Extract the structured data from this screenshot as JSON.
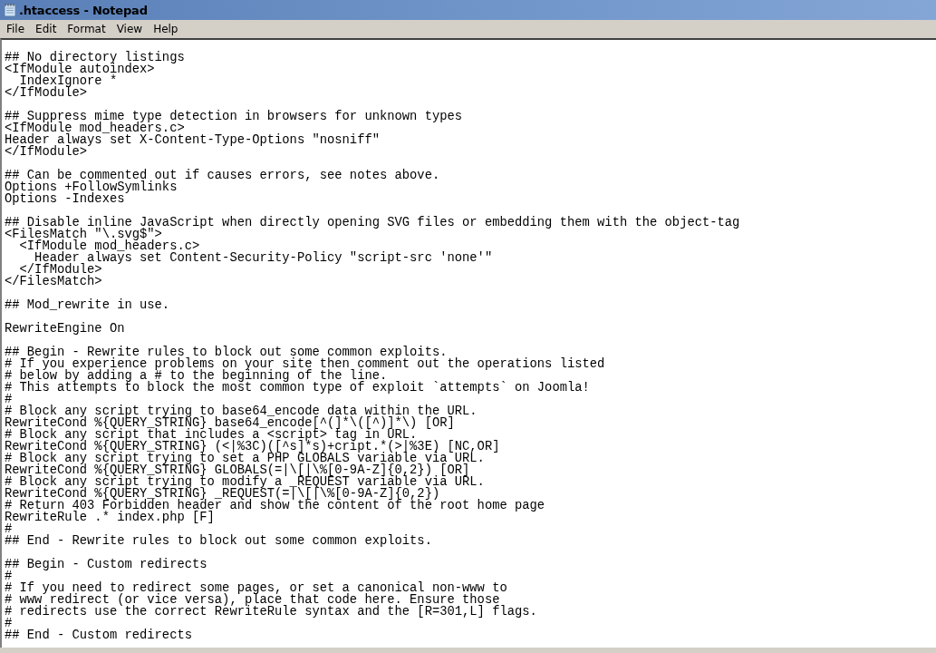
{
  "window": {
    "title": ".htaccess - Notepad"
  },
  "menu": [
    "File",
    "Edit",
    "Format",
    "View",
    "Help"
  ],
  "editor": {
    "blocks": [
      [
        "## No directory listings",
        "<IfModule autoindex>",
        "  IndexIgnore *",
        "</IfModule>"
      ],
      [
        "## Suppress mime type detection in browsers for unknown types",
        "<IfModule mod_headers.c>",
        "Header always set X-Content-Type-Options \"nosniff\"",
        "</IfModule>"
      ],
      [
        "## Can be commented out if causes errors, see notes above.",
        "Options +FollowSymlinks",
        "Options -Indexes"
      ],
      [
        "## Disable inline JavaScript when directly opening SVG files or embedding them with the object-tag",
        "<FilesMatch \"\\.svg$\">",
        "  <IfModule mod_headers.c>",
        "    Header always set Content-Security-Policy \"script-src 'none'\"",
        "  </IfModule>",
        "</FilesMatch>"
      ],
      [
        "## Mod_rewrite in use."
      ],
      [
        "RewriteEngine On"
      ],
      [
        "## Begin - Rewrite rules to block out some common exploits.",
        "# If you experience problems on your site then comment out the operations listed",
        "# below by adding a # to the beginning of the line.",
        "# This attempts to block the most common type of exploit `attempts` on Joomla!",
        "#",
        "# Block any script trying to base64_encode data within the URL.",
        "RewriteCond %{QUERY_STRING} base64_encode[^(]*\\([^)]*\\) [OR]",
        "# Block any script that includes a <script> tag in URL.",
        "RewriteCond %{QUERY_STRING} (<|%3C)([^s]*s)+cript.*(>|%3E) [NC,OR]",
        "# Block any script trying to set a PHP GLOBALS variable via URL.",
        "RewriteCond %{QUERY_STRING} GLOBALS(=|\\[|\\%[0-9A-Z]{0,2}) [OR]",
        "# Block any script trying to modify a _REQUEST variable via URL.",
        "RewriteCond %{QUERY_STRING} _REQUEST(=|\\[|\\%[0-9A-Z]{0,2})",
        "# Return 403 Forbidden header and show the content of the root home page",
        "RewriteRule .* index.php [F]",
        "#",
        "## End - Rewrite rules to block out some common exploits."
      ],
      [
        "## Begin - Custom redirects",
        "#",
        "# If you need to redirect some pages, or set a canonical non-www to",
        "# www redirect (or vice versa), place that code here. Ensure those",
        "# redirects use the correct RewriteRule syntax and the [R=301,L] flags.",
        "#",
        "## End - Custom redirects"
      ]
    ]
  }
}
